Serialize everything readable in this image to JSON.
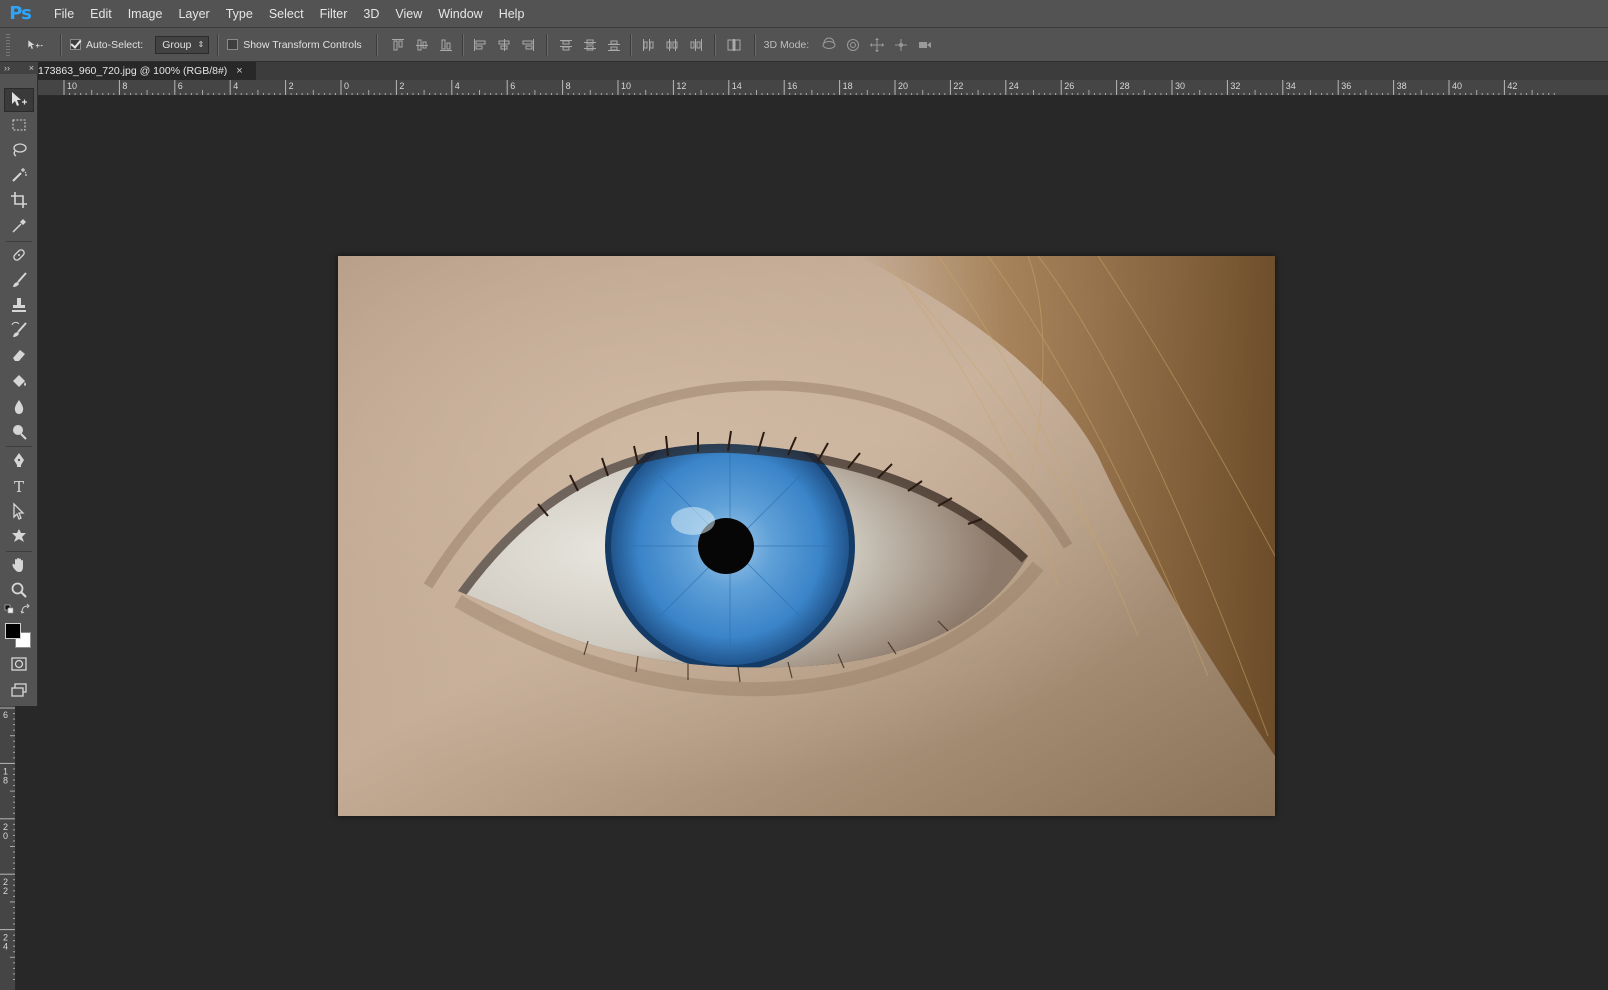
{
  "app": {
    "logo": "Ps"
  },
  "menu": [
    "File",
    "Edit",
    "Image",
    "Layer",
    "Type",
    "Select",
    "Filter",
    "3D",
    "View",
    "Window",
    "Help"
  ],
  "options": {
    "auto_select_label": "Auto-Select:",
    "auto_select_checked": true,
    "group_value": "Group",
    "show_transform_label": "Show Transform Controls",
    "show_transform_checked": false,
    "mode3d_label": "3D Mode:"
  },
  "document": {
    "tab_label": "173863_960_720.jpg @ 100% (RGB/8#)",
    "close_symbol": "×"
  },
  "panel": {
    "collapse_symbol": "››",
    "close_symbol": "×"
  },
  "ruler": {
    "h_labels": [
      "10",
      "8",
      "6",
      "4",
      "2",
      "0",
      "2",
      "4",
      "6",
      "8",
      "10",
      "12",
      "14",
      "16",
      "18",
      "20",
      "22",
      "24",
      "26",
      "28",
      "30",
      "32",
      "34",
      "36",
      "38",
      "40",
      "42"
    ],
    "v_labels": [
      "6",
      "8",
      "0",
      "2",
      "4"
    ],
    "v_label_secondary": [
      "",
      "1",
      "2",
      "2",
      "2"
    ]
  },
  "colors": {
    "foreground": "#000000",
    "background": "#ffffff",
    "logo": "#2fa3f7",
    "iris": "#3a84c8"
  },
  "tools": [
    "move-tool",
    "marquee-tool",
    "lasso-tool",
    "magic-wand-tool",
    "crop-tool",
    "eyedropper-tool",
    "healing-brush-tool",
    "brush-tool",
    "clone-stamp-tool",
    "history-brush-tool",
    "eraser-tool",
    "paint-bucket-tool",
    "blur-tool",
    "dodge-tool",
    "pen-tool",
    "type-tool",
    "path-selection-tool",
    "custom-shape-tool",
    "hand-tool",
    "zoom-tool"
  ]
}
